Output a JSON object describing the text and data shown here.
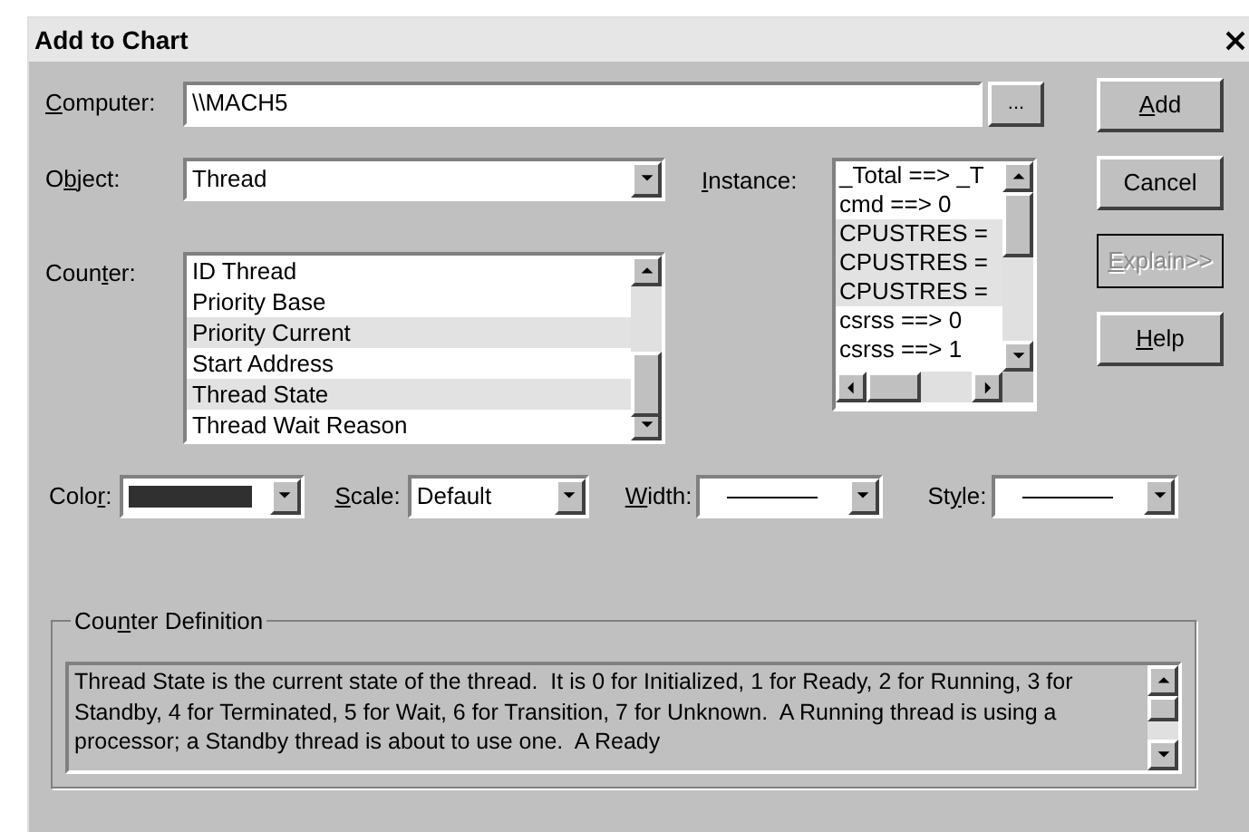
{
  "window": {
    "title": "Add to Chart"
  },
  "computer": {
    "label": {
      "key": "C",
      "after": "omputer:"
    },
    "value": "\\\\MACH5",
    "browse": "..."
  },
  "object": {
    "label": {
      "before": "O",
      "key": "b",
      "after": "ject:"
    },
    "value": "Thread"
  },
  "counter": {
    "label": {
      "before": "Coun",
      "key": "t",
      "after": "er:"
    },
    "items": [
      {
        "text": "ID Thread",
        "selected": false
      },
      {
        "text": "Priority Base",
        "selected": false
      },
      {
        "text": "Priority Current",
        "selected": true
      },
      {
        "text": "Start Address",
        "selected": false
      },
      {
        "text": "Thread State",
        "selected": true
      },
      {
        "text": "Thread Wait Reason",
        "selected": false
      }
    ]
  },
  "instance": {
    "label": {
      "key": "I",
      "after": "nstance:"
    },
    "items": [
      {
        "text": "_Total ==> _T",
        "selected": false
      },
      {
        "text": "cmd ==> 0",
        "selected": false
      },
      {
        "text": "CPUSTRES =",
        "selected": true
      },
      {
        "text": "CPUSTRES =",
        "selected": true
      },
      {
        "text": "CPUSTRES =",
        "selected": true
      },
      {
        "text": "csrss ==> 0",
        "selected": false
      },
      {
        "text": "csrss ==> 1",
        "selected": false
      }
    ]
  },
  "buttons": [
    {
      "label": {
        "key": "A",
        "after": "dd"
      },
      "disabled": false
    },
    {
      "label": {
        "before": "Cancel"
      },
      "disabled": false
    },
    {
      "label": {
        "key": "E",
        "after": "xplain>>"
      },
      "disabled": true
    },
    {
      "label": {
        "key": "H",
        "after": "elp"
      },
      "disabled": false
    }
  ],
  "options": [
    {
      "kind": "color",
      "label": {
        "before": "Colo",
        "key": "r",
        "after": ":"
      },
      "color": "#303030"
    },
    {
      "kind": "text",
      "label": {
        "key": "S",
        "after": "cale:"
      },
      "value": "Default"
    },
    {
      "kind": "line",
      "label": {
        "key": "W",
        "after": "idth:"
      }
    },
    {
      "kind": "line",
      "label": {
        "before": "St",
        "key": "y",
        "after": "le:"
      }
    }
  ],
  "definition": {
    "label": {
      "before": "Cou",
      "key": "n",
      "after": "ter Definition"
    },
    "text": "Thread State is the current state of the thread.  It is 0 for Initialized, 1 for Ready, 2 for Running, 3 for Standby, 4 for Terminated, 5 for Wait, 6 for Transition, 7 for Unknown.  A Running thread is using a processor; a Standby thread is about to use one.  A Ready"
  }
}
